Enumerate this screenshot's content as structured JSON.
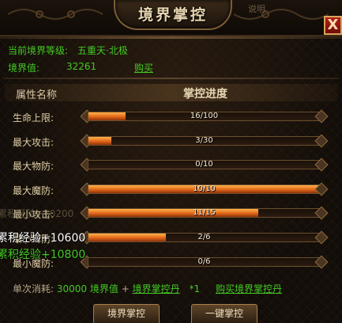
{
  "window": {
    "title": "境界掌控",
    "ghost_tab": "说明",
    "close_label": "X"
  },
  "info": {
    "level_label": "当前境界等级:",
    "level_value": "五重天·北极",
    "points_label": "境界值:",
    "points_value": "32261",
    "buy_label": "购买"
  },
  "table": {
    "attr_header": "属性名称",
    "progress_header": "掌控进度",
    "rows": [
      {
        "label": "生命上限:",
        "current": 16,
        "max": 100,
        "text": "16/100"
      },
      {
        "label": "最大攻击:",
        "current": 3,
        "max": 30,
        "text": "3/30"
      },
      {
        "label": "最大物防:",
        "current": 0,
        "max": 10,
        "text": "0/10"
      },
      {
        "label": "最大魔防:",
        "current": 10,
        "max": 10,
        "text": "10/10"
      },
      {
        "label": "最小攻击:",
        "current": 11,
        "max": 15,
        "text": "11/15"
      },
      {
        "label": "最小物防:",
        "current": 2,
        "max": 6,
        "text": "2/6"
      },
      {
        "label": "最小魔防:",
        "current": 0,
        "max": 6,
        "text": "0/6"
      }
    ]
  },
  "overlays": {
    "ghost_line": "累积经验+10200",
    "line_1": "累积经验+10600",
    "line_2": "累积经验+10800"
  },
  "cost": {
    "prefix": "单次消耗:",
    "amount": "30000",
    "points_word": "境界值",
    "plus": "+",
    "item": "境界掌控丹",
    "count": "*1",
    "buy_item": "购买境界掌控丹"
  },
  "buttons": {
    "control": "境界掌控",
    "one_click": "一键掌控"
  },
  "colors": {
    "accent_green": "#43c923",
    "bar_fill": "#e0661a",
    "close_red": "#b22016"
  }
}
